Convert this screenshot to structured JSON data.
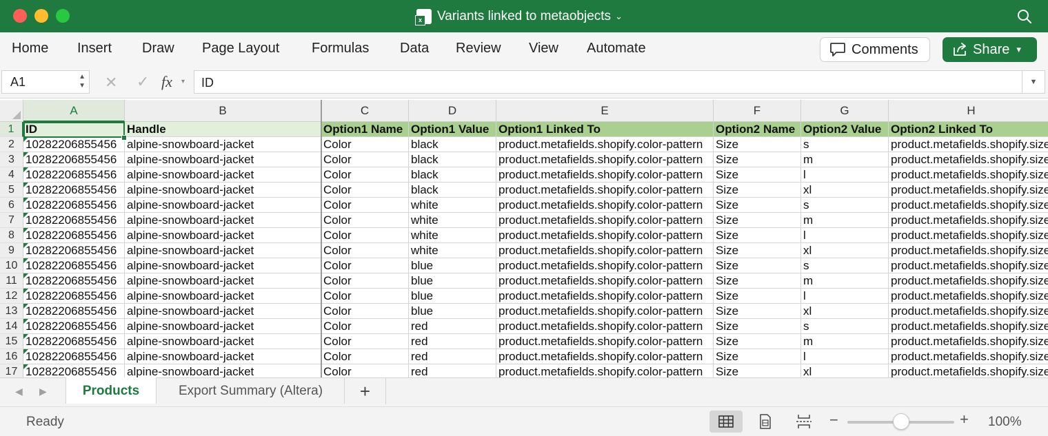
{
  "window": {
    "title": "Variants linked to metaobjects",
    "title_chevron": "⌄"
  },
  "ribbon": {
    "tabs": [
      "Home",
      "Insert",
      "Draw",
      "Page Layout",
      "Formulas",
      "Data",
      "Review",
      "View",
      "Automate"
    ],
    "comments_label": "Comments",
    "share_label": "Share"
  },
  "formula_bar": {
    "name_box": "A1",
    "fx_label": "fx",
    "value": "ID"
  },
  "grid": {
    "columns": [
      "A",
      "B",
      "C",
      "D",
      "E",
      "F",
      "G",
      "H"
    ],
    "selected_cell": "A1",
    "header_row": [
      "ID",
      "Handle",
      "Option1 Name",
      "Option1 Value",
      "Option1 Linked To",
      "Option2 Name",
      "Option2 Value",
      "Option2 Linked To"
    ],
    "rows": [
      {
        "n": "2",
        "cells": [
          "10282206855456",
          "alpine-snowboard-jacket",
          "Color",
          "black",
          "product.metafields.shopify.color-pattern",
          "Size",
          "s",
          "product.metafields.shopify.size"
        ]
      },
      {
        "n": "3",
        "cells": [
          "10282206855456",
          "alpine-snowboard-jacket",
          "Color",
          "black",
          "product.metafields.shopify.color-pattern",
          "Size",
          "m",
          "product.metafields.shopify.size"
        ]
      },
      {
        "n": "4",
        "cells": [
          "10282206855456",
          "alpine-snowboard-jacket",
          "Color",
          "black",
          "product.metafields.shopify.color-pattern",
          "Size",
          "l",
          "product.metafields.shopify.size"
        ]
      },
      {
        "n": "5",
        "cells": [
          "10282206855456",
          "alpine-snowboard-jacket",
          "Color",
          "black",
          "product.metafields.shopify.color-pattern",
          "Size",
          "xl",
          "product.metafields.shopify.size"
        ]
      },
      {
        "n": "6",
        "cells": [
          "10282206855456",
          "alpine-snowboard-jacket",
          "Color",
          "white",
          "product.metafields.shopify.color-pattern",
          "Size",
          "s",
          "product.metafields.shopify.size"
        ]
      },
      {
        "n": "7",
        "cells": [
          "10282206855456",
          "alpine-snowboard-jacket",
          "Color",
          "white",
          "product.metafields.shopify.color-pattern",
          "Size",
          "m",
          "product.metafields.shopify.size"
        ]
      },
      {
        "n": "8",
        "cells": [
          "10282206855456",
          "alpine-snowboard-jacket",
          "Color",
          "white",
          "product.metafields.shopify.color-pattern",
          "Size",
          "l",
          "product.metafields.shopify.size"
        ]
      },
      {
        "n": "9",
        "cells": [
          "10282206855456",
          "alpine-snowboard-jacket",
          "Color",
          "white",
          "product.metafields.shopify.color-pattern",
          "Size",
          "xl",
          "product.metafields.shopify.size"
        ]
      },
      {
        "n": "10",
        "cells": [
          "10282206855456",
          "alpine-snowboard-jacket",
          "Color",
          "blue",
          "product.metafields.shopify.color-pattern",
          "Size",
          "s",
          "product.metafields.shopify.size"
        ]
      },
      {
        "n": "11",
        "cells": [
          "10282206855456",
          "alpine-snowboard-jacket",
          "Color",
          "blue",
          "product.metafields.shopify.color-pattern",
          "Size",
          "m",
          "product.metafields.shopify.size"
        ]
      },
      {
        "n": "12",
        "cells": [
          "10282206855456",
          "alpine-snowboard-jacket",
          "Color",
          "blue",
          "product.metafields.shopify.color-pattern",
          "Size",
          "l",
          "product.metafields.shopify.size"
        ]
      },
      {
        "n": "13",
        "cells": [
          "10282206855456",
          "alpine-snowboard-jacket",
          "Color",
          "blue",
          "product.metafields.shopify.color-pattern",
          "Size",
          "xl",
          "product.metafields.shopify.size"
        ]
      },
      {
        "n": "14",
        "cells": [
          "10282206855456",
          "alpine-snowboard-jacket",
          "Color",
          "red",
          "product.metafields.shopify.color-pattern",
          "Size",
          "s",
          "product.metafields.shopify.size"
        ]
      },
      {
        "n": "15",
        "cells": [
          "10282206855456",
          "alpine-snowboard-jacket",
          "Color",
          "red",
          "product.metafields.shopify.color-pattern",
          "Size",
          "m",
          "product.metafields.shopify.size"
        ]
      },
      {
        "n": "16",
        "cells": [
          "10282206855456",
          "alpine-snowboard-jacket",
          "Color",
          "red",
          "product.metafields.shopify.color-pattern",
          "Size",
          "l",
          "product.metafields.shopify.size"
        ]
      },
      {
        "n": "17",
        "cells": [
          "10282206855456",
          "alpine-snowboard-jacket",
          "Color",
          "red",
          "product.metafields.shopify.color-pattern",
          "Size",
          "xl",
          "product.metafields.shopify.size"
        ]
      }
    ]
  },
  "sheets": {
    "tabs": [
      "Products",
      "Export Summary (Altera)"
    ],
    "active_index": 0,
    "add_label": "+"
  },
  "status": {
    "text": "Ready",
    "zoom": "100%",
    "zoom_fraction": 0.5
  },
  "colors": {
    "accent": "#1e7a3e",
    "header_fill_green": "#a9d08e",
    "header_fill_light": "#e2efda",
    "close": "#ff5f57",
    "minimize": "#febc2e",
    "maximize": "#28c840"
  }
}
